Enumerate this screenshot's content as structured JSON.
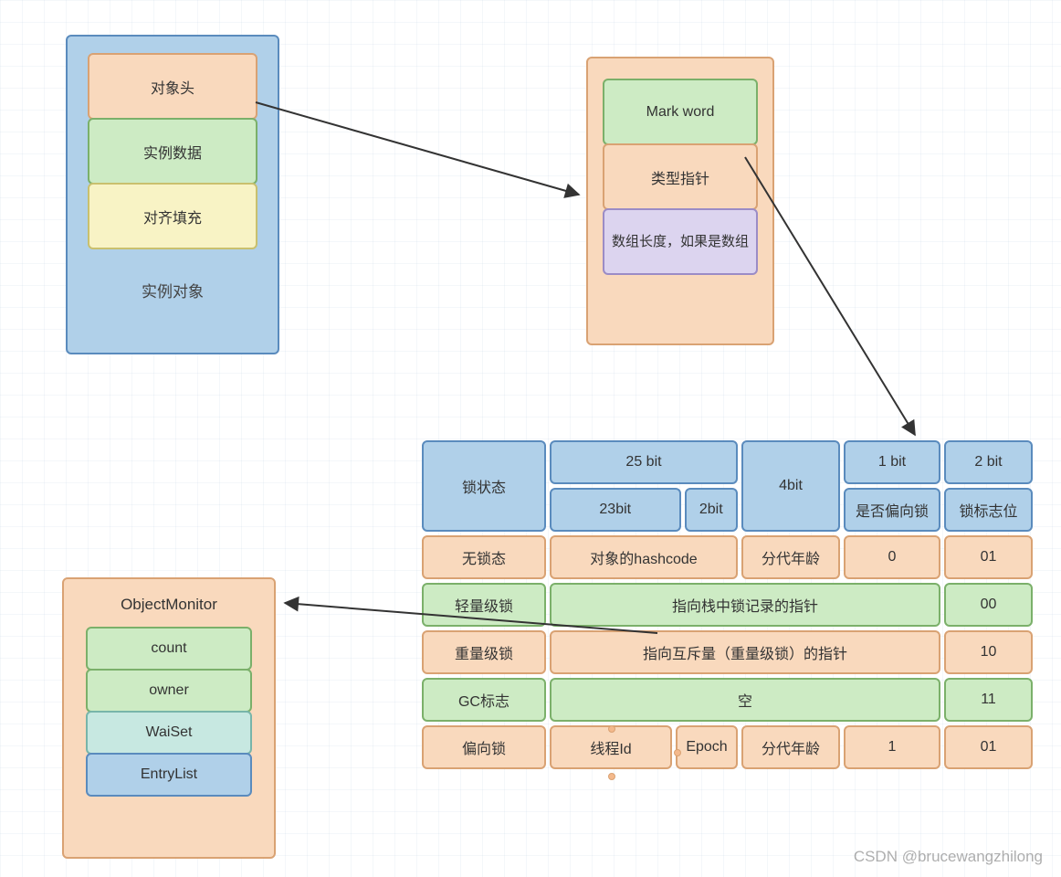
{
  "instance": {
    "label": "实例对象",
    "rows": {
      "header": "对象头",
      "data": "实例数据",
      "padding": "对齐填充"
    }
  },
  "header": {
    "mark": "Mark  word",
    "klass": "类型指针",
    "arraylen": "数组长度，如果是数组"
  },
  "monitor": {
    "title": "ObjectMonitor",
    "fields": {
      "count": "count",
      "owner": "owner",
      "waitset": "WaiSet",
      "entrylist": "EntryList"
    }
  },
  "table": {
    "head": {
      "c0": "锁状态",
      "c1": "25 bit",
      "c1a": "23bit",
      "c1b": "2bit",
      "c2": "4bit",
      "c3": "1 bit",
      "c3a": "是否偏向锁",
      "c4": "2 bit",
      "c4a": "锁标志位"
    },
    "rows": {
      "nolock": {
        "name": "无锁态",
        "desc": "对象的hashcode",
        "age": "分代年龄",
        "bias": "0",
        "flag": "01"
      },
      "light": {
        "name": "轻量级锁",
        "desc": "指向栈中锁记录的指针",
        "flag": "00"
      },
      "heavy": {
        "name": "重量级锁",
        "desc": "指向互斥量（重量级锁）的指针",
        "flag": "10"
      },
      "gc": {
        "name": "GC标志",
        "desc": "空",
        "flag": "11"
      },
      "biased": {
        "name": "偏向锁",
        "tid": "线程Id",
        "epoch": "Epoch",
        "age": "分代年龄",
        "bias": "1",
        "flag": "01"
      }
    }
  },
  "watermark": "CSDN @brucewangzhilong"
}
